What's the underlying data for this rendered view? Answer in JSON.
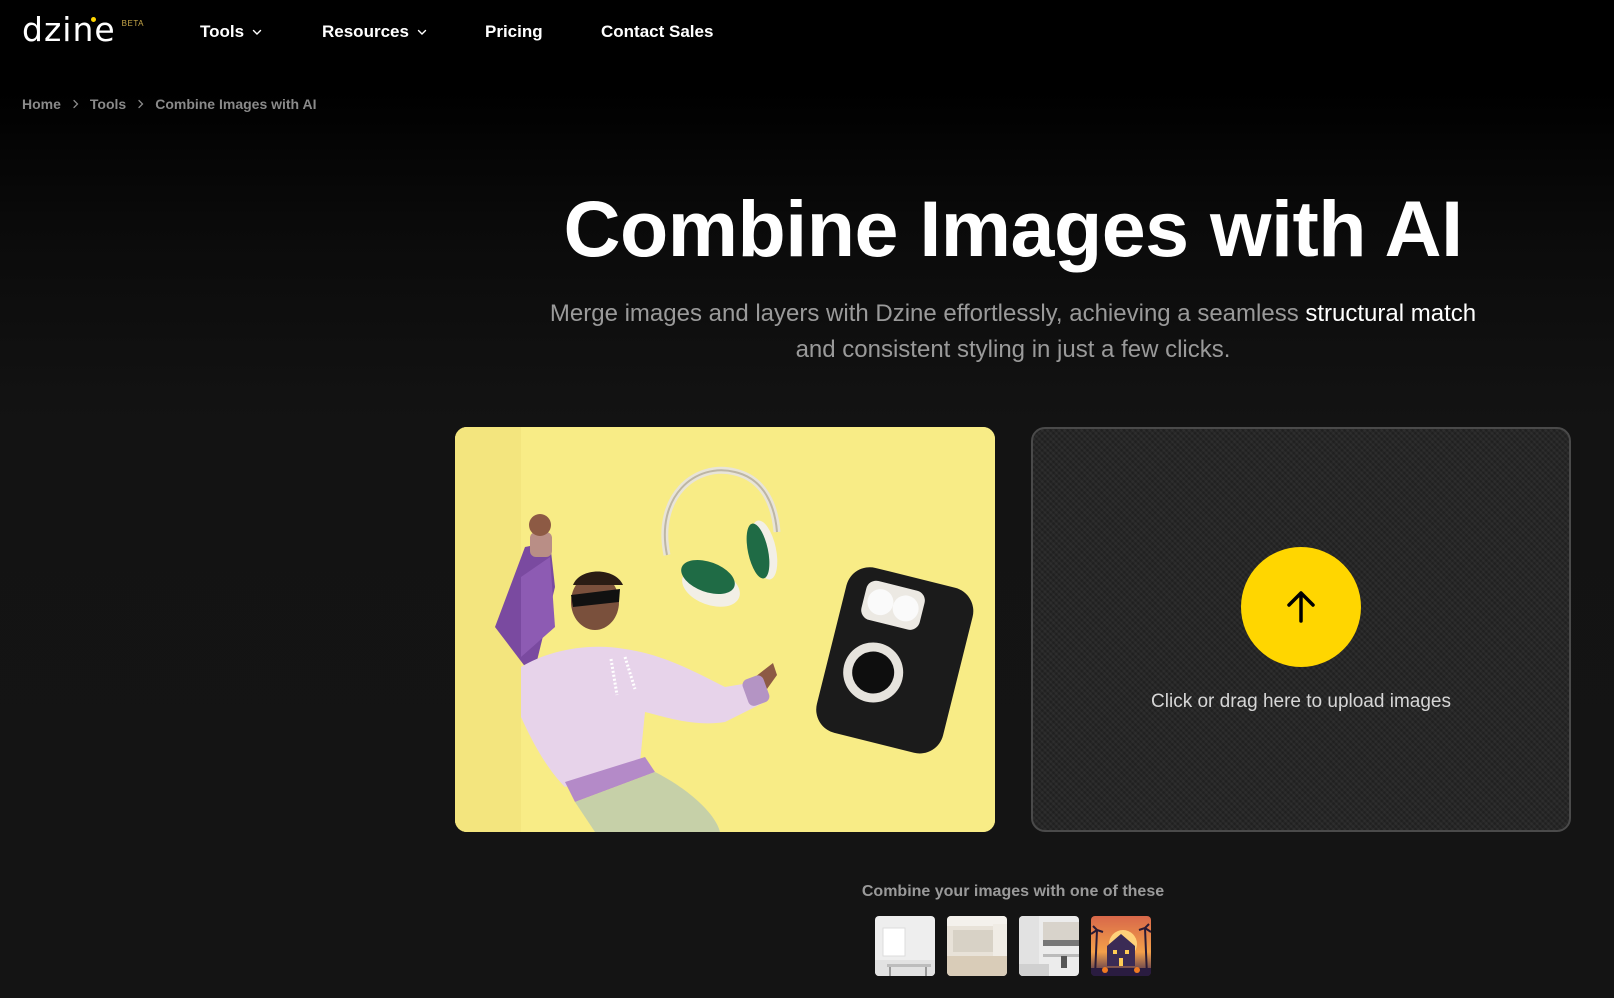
{
  "nav": {
    "logo_text": "dzine",
    "logo_badge": "BETA",
    "items": [
      {
        "label": "Tools",
        "has_dropdown": true,
        "icon": "chevron-down-icon"
      },
      {
        "label": "Resources",
        "has_dropdown": true,
        "icon": "chevron-down-icon"
      },
      {
        "label": "Pricing",
        "has_dropdown": false
      },
      {
        "label": "Contact Sales",
        "has_dropdown": false
      }
    ]
  },
  "breadcrumb": {
    "items": [
      "Home",
      "Tools",
      "Combine Images with AI"
    ],
    "separator_icon": "chevron-right-icon"
  },
  "hero": {
    "title": "Combine Images with AI",
    "subtitle_part1": "Merge images and layers with Dzine effortlessly, achieving a seamless ",
    "subtitle_highlight": "structural match",
    "subtitle_part2": " and consistent styling in just a few clicks."
  },
  "demo_image": {
    "alt": "3D character in purple hoodie dancing with floating headphones and speaker on yellow background"
  },
  "upload": {
    "icon": "arrow-up-icon",
    "label": "Click or drag here to upload images"
  },
  "templates": {
    "label": "Combine your images with one of these",
    "items": [
      {
        "name": "white-room-with-frame"
      },
      {
        "name": "empty-beige-room"
      },
      {
        "name": "modern-kitchen-office"
      },
      {
        "name": "halloween-haunted-house"
      }
    ]
  },
  "colors": {
    "accent": "#FFD600",
    "background": "#141414",
    "demo_background": "#F8EC86"
  }
}
